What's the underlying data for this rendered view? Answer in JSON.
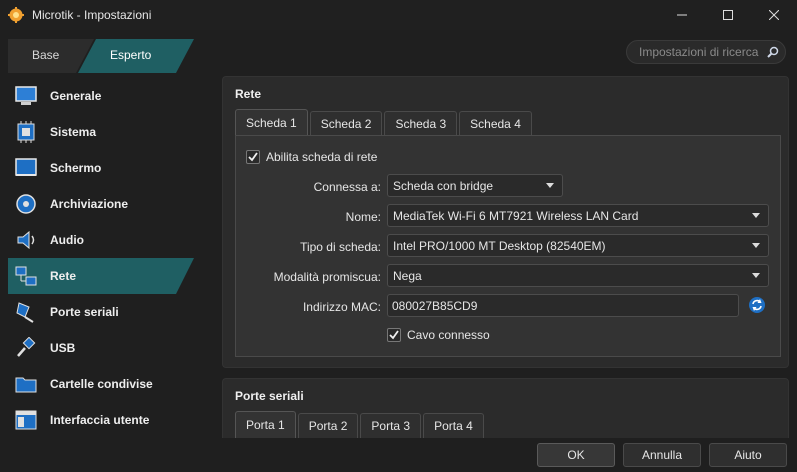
{
  "window": {
    "title": "Microtik - Impostazioni",
    "minimize": "—",
    "maximize": "☐",
    "close": "✕"
  },
  "mode_tabs": {
    "basic": "Base",
    "expert": "Esperto"
  },
  "search": {
    "placeholder": "Impostazioni di ricerca"
  },
  "sidebar": {
    "items": [
      {
        "label": "Generale",
        "icon": "monitor-general-icon"
      },
      {
        "label": "Sistema",
        "icon": "chip-icon"
      },
      {
        "label": "Schermo",
        "icon": "display-icon"
      },
      {
        "label": "Archiviazione",
        "icon": "disk-icon"
      },
      {
        "label": "Audio",
        "icon": "speaker-icon"
      },
      {
        "label": "Rete",
        "icon": "network-icon"
      },
      {
        "label": "Porte seriali",
        "icon": "serial-plug-icon"
      },
      {
        "label": "USB",
        "icon": "usb-icon"
      },
      {
        "label": "Cartelle condivise",
        "icon": "folder-icon"
      },
      {
        "label": "Interfaccia utente",
        "icon": "window-icon"
      }
    ],
    "active_index": 5
  },
  "network": {
    "title": "Rete",
    "tabs": [
      "Scheda 1",
      "Scheda 2",
      "Scheda 3",
      "Scheda 4"
    ],
    "enable_label": "Abilita scheda di rete",
    "enabled": true,
    "attached_label": "Connessa a:",
    "attached_value": "Scheda con bridge",
    "name_label": "Nome:",
    "name_value": "MediaTek Wi-Fi 6 MT7921 Wireless LAN Card",
    "adapter_type_label": "Tipo di scheda:",
    "adapter_type_value": "Intel PRO/1000 MT Desktop (82540EM)",
    "promisc_label": "Modalità promiscua:",
    "promisc_value": "Nega",
    "mac_label": "Indirizzo MAC:",
    "mac_value": "080027B85CD9",
    "cable_label": "Cavo connesso",
    "cable_connected": true
  },
  "serial": {
    "title": "Porte seriali",
    "tabs": [
      "Porta 1",
      "Porta 2",
      "Porta 3",
      "Porta 4"
    ]
  },
  "buttons": {
    "ok": "OK",
    "cancel": "Annulla",
    "help": "Aiuto"
  },
  "colors": {
    "accent": "#1f5f63",
    "background": "#1f1f1f",
    "panel": "#2b2b2b"
  }
}
